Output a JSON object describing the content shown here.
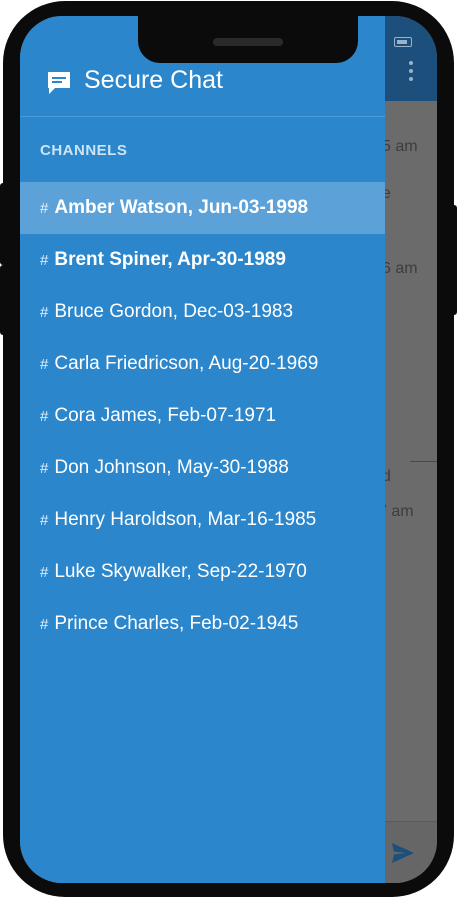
{
  "app": {
    "title": "Secure Chat"
  },
  "drawer": {
    "section_label": "CHANNELS",
    "channels": [
      {
        "hash": "#",
        "name": "Amber Watson, Jun-03-1998",
        "active": true,
        "bold": true
      },
      {
        "hash": "#",
        "name": "Brent Spiner, Apr-30-1989",
        "active": false,
        "bold": true
      },
      {
        "hash": "#",
        "name": "Bruce Gordon, Dec-03-1983",
        "active": false,
        "bold": false
      },
      {
        "hash": "#",
        "name": "Carla Friedricson, Aug-20-1969",
        "active": false,
        "bold": false
      },
      {
        "hash": "#",
        "name": "Cora James, Feb-07-1971",
        "active": false,
        "bold": false
      },
      {
        "hash": "#",
        "name": "Don Johnson, May-30-1988",
        "active": false,
        "bold": false
      },
      {
        "hash": "#",
        "name": "Henry Haroldson, Mar-16-1985",
        "active": false,
        "bold": false
      },
      {
        "hash": "#",
        "name": "Luke Skywalker, Sep-22-1970",
        "active": false,
        "bold": false
      },
      {
        "hash": "#",
        "name": "Prince Charles, Feb-02-1945",
        "active": false,
        "bold": false
      }
    ]
  },
  "background_chat": {
    "fragments": [
      "5 am",
      "e",
      "6 am",
      "d",
      "7 am"
    ]
  },
  "colors": {
    "drawer_bg": "#2b86cb",
    "active_row": "#5ca2d8",
    "appbar_dim": "#1d4f7c"
  },
  "icons": {
    "header": "chat-bubble-icon",
    "menu": "more-vertical-icon",
    "send": "send-icon",
    "battery": "battery-icon"
  }
}
